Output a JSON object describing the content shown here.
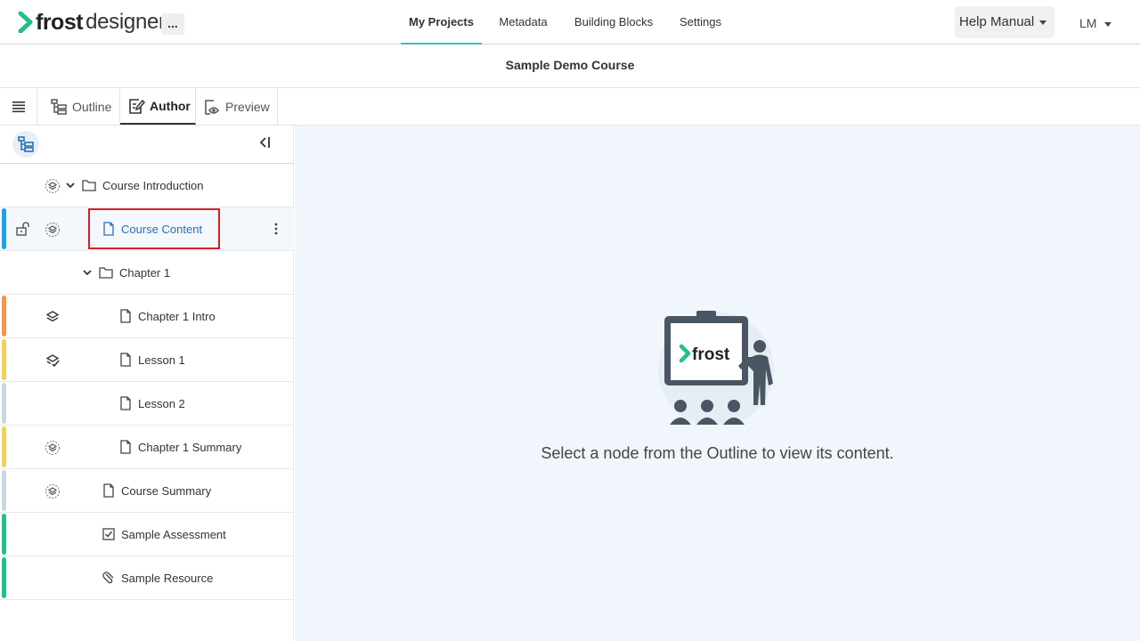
{
  "app": {
    "logo_frost": "frost",
    "logo_designer": "designer",
    "more_label": "...",
    "nav": [
      {
        "label": "My Projects",
        "active": true
      },
      {
        "label": "Metadata",
        "active": false
      },
      {
        "label": "Building Blocks",
        "active": false
      },
      {
        "label": "Settings",
        "active": false
      }
    ],
    "help_label": "Help Manual",
    "user_initials": "LM",
    "accent_color": "#3fb8d6",
    "brand_green": "#1fc08a"
  },
  "course": {
    "title": "Sample Demo Course"
  },
  "tabs": [
    {
      "label": "Outline",
      "active": false
    },
    {
      "label": "Author",
      "active": true
    },
    {
      "label": "Preview",
      "active": false
    }
  ],
  "panel": {
    "collapse_label": "<I"
  },
  "outline": [
    {
      "label": "Course Introduction",
      "type": "folder",
      "expanded": true,
      "status": "in-progress",
      "bar": ""
    },
    {
      "label": "Course Content",
      "type": "page",
      "status": "in-progress",
      "bar": "#1aa3e0",
      "selected": true,
      "lock": true
    },
    {
      "label": "Chapter 1",
      "type": "folder",
      "expanded": true,
      "status": "",
      "bar": ""
    },
    {
      "label": "Chapter 1 Intro",
      "type": "page",
      "status": "layers",
      "bar": "#f5964a"
    },
    {
      "label": "Lesson 1",
      "type": "page",
      "status": "layers-check",
      "bar": "#f6cf57"
    },
    {
      "label": "Lesson 2",
      "type": "page",
      "status": "",
      "bar": "#c9d8dc"
    },
    {
      "label": "Chapter 1 Summary",
      "type": "page",
      "status": "in-progress",
      "bar": "#f6cf57"
    },
    {
      "label": "Course Summary",
      "type": "page",
      "status": "in-progress",
      "bar": "#c9d8dc"
    },
    {
      "label": "Sample Assessment",
      "type": "assessment",
      "status": "",
      "bar": "#22c08c"
    },
    {
      "label": "Sample Resource",
      "type": "resource",
      "status": "",
      "bar": "#22c08c"
    }
  ],
  "main": {
    "illustration_brand": "frost",
    "empty_message": "Select a node from the Outline to view its content."
  }
}
